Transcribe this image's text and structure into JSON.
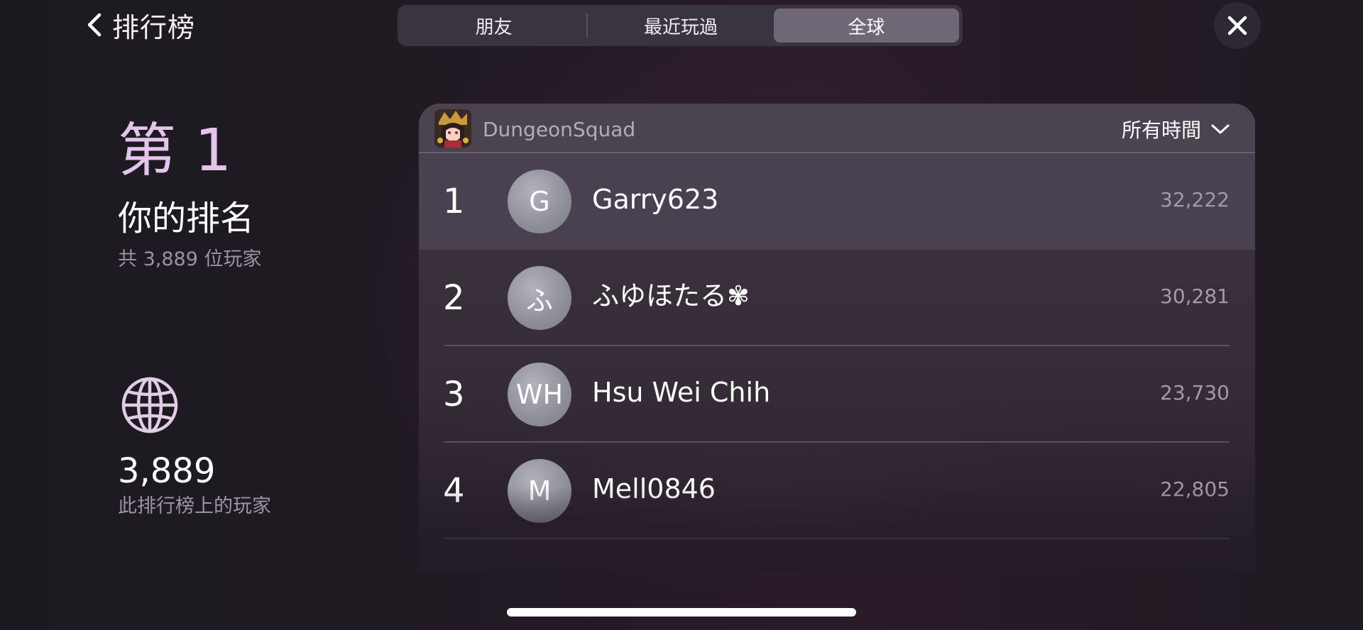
{
  "header": {
    "back_label": "排行榜",
    "tabs": [
      {
        "label": "朋友",
        "active": false
      },
      {
        "label": "最近玩過",
        "active": false
      },
      {
        "label": "全球",
        "active": true
      }
    ]
  },
  "my_rank": {
    "rank": "第 1",
    "title": "你的排名",
    "subtitle": "共 3,889 位玩家"
  },
  "stats": {
    "icon": "globe-icon",
    "count": "3,889",
    "label": "此排行榜上的玩家"
  },
  "leaderboard": {
    "game_name": "DungeonSquad",
    "time_filter": "所有時間",
    "entries": [
      {
        "rank": "1",
        "avatar": "G",
        "name": "Garry623",
        "score": "32,222",
        "highlight": true
      },
      {
        "rank": "2",
        "avatar": "ふ",
        "name": "ふゆほたる✾",
        "score": "30,281",
        "highlight": false
      },
      {
        "rank": "3",
        "avatar": "WH",
        "name": "Hsu Wei Chih",
        "score": "23,730",
        "highlight": false
      },
      {
        "rank": "4",
        "avatar": "M",
        "name": "Mell0846",
        "score": "22,805",
        "highlight": false
      }
    ]
  },
  "colors": {
    "accent_rank": "#e4c4ea",
    "active_tab": "#6f6775",
    "highlight_row": "#4a4150"
  }
}
